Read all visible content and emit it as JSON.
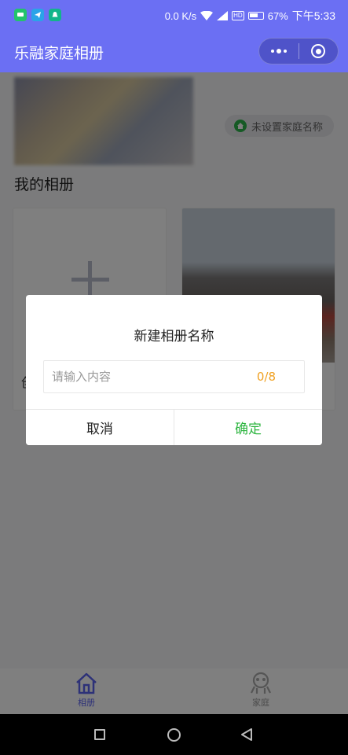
{
  "status_bar": {
    "speed": "0.0 K/s",
    "signal_label": "HD",
    "battery_percent": "67%",
    "time": "下午5:33",
    "battery_level": 0.67
  },
  "nav": {
    "title": "乐融家庭相册"
  },
  "page": {
    "family_tag": "未设置家庭名称",
    "section_title": "我的相册",
    "create_card_label": "创"
  },
  "dialog": {
    "title": "新建相册名称",
    "input_placeholder": "请输入内容",
    "input_value": "",
    "counter": "0/8",
    "cancel_label": "取消",
    "confirm_label": "确定"
  },
  "tabbar": {
    "albums_label": "相册",
    "family_label": "家庭"
  },
  "colors": {
    "brand": "#6b6ff3",
    "tab_active": "#5b62f0",
    "confirm": "#2db540",
    "counter": "#f0a020"
  }
}
